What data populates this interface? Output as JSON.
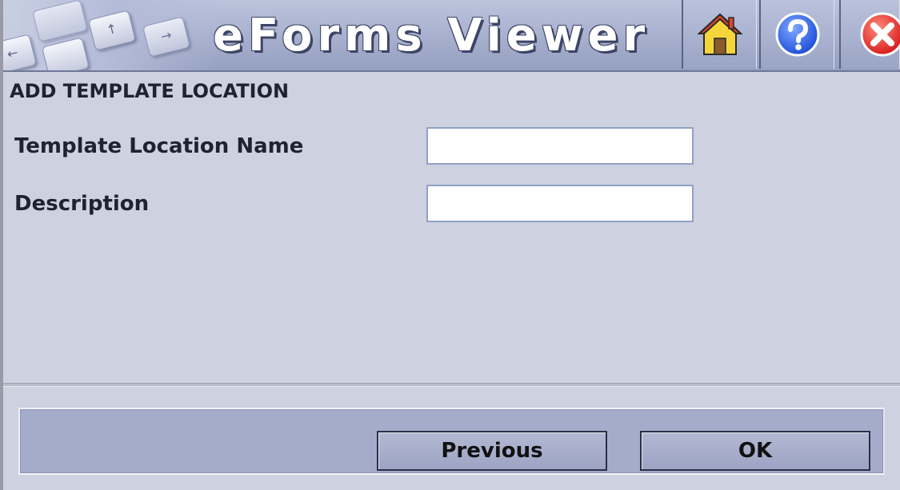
{
  "header": {
    "app_title": "eForms Viewer",
    "buttons": [
      {
        "name": "home",
        "icon": "home-icon"
      },
      {
        "name": "help",
        "icon": "help-icon"
      },
      {
        "name": "close",
        "icon": "close-icon"
      }
    ],
    "keyboard_keys": [
      "←",
      "↑",
      "→"
    ]
  },
  "form": {
    "title": "ADD TEMPLATE LOCATION",
    "fields": [
      {
        "label": "Template Location Name",
        "value": "",
        "placeholder": ""
      },
      {
        "label": "Description",
        "value": "",
        "placeholder": ""
      }
    ]
  },
  "footer": {
    "previous_label": "Previous",
    "ok_label": "OK"
  },
  "colors": {
    "background": "#cdd1e0",
    "header": "#a6afcd",
    "button_bar": "#a4abcb",
    "help_blue": "#1f4fd8",
    "close_red": "#d81e1e",
    "home_yellow": "#f5d53a"
  }
}
